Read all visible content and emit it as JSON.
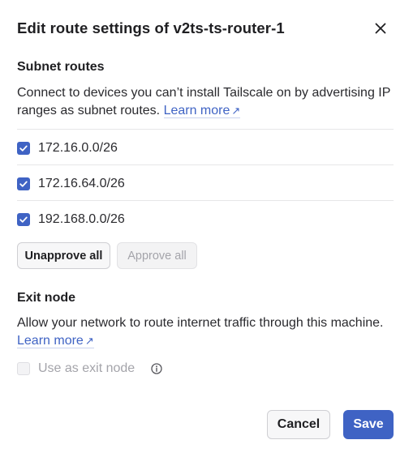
{
  "dialog": {
    "title": "Edit route settings of v2ts-ts-router-1",
    "close_icon": "close-icon"
  },
  "subnet": {
    "heading": "Subnet routes",
    "description": "Connect to devices you can’t install Tailscale on by advertising IP ranges as subnet routes.",
    "learn_more": "Learn more",
    "link_icon": "external-arrow-icon",
    "routes": [
      {
        "label": "172.16.0.0/26",
        "checked": true
      },
      {
        "label": "172.16.64.0/26",
        "checked": true
      },
      {
        "label": "192.168.0.0/26",
        "checked": true
      }
    ],
    "unapprove_label": "Unapprove all",
    "approve_label": "Approve all"
  },
  "exit": {
    "heading": "Exit node",
    "description": "Allow your network to route internet traffic through this machine.",
    "learn_more": "Learn more",
    "option_label": "Use as exit node",
    "option_checked": false,
    "option_disabled": true,
    "info_icon": "info-icon"
  },
  "footer": {
    "cancel_label": "Cancel",
    "save_label": "Save"
  },
  "colors": {
    "accent": "#3f63c4",
    "disabled_text": "#a4a4aa"
  }
}
